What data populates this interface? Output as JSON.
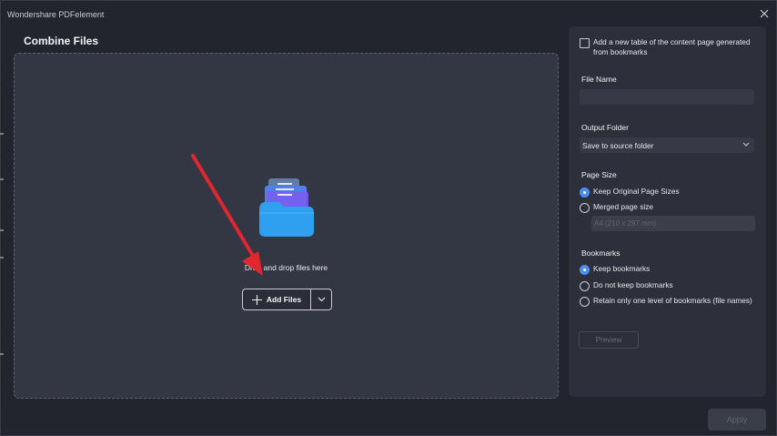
{
  "app": {
    "title": "Wondershare PDFelement"
  },
  "main": {
    "heading": "Combine Files",
    "drop_text": "Drag and drop files here",
    "add_files_label": "Add Files"
  },
  "panel": {
    "toc_checkbox_label": "Add a new table of the content page generated from bookmarks",
    "toc_checked": false,
    "file_name_label": "File Name",
    "file_name_value": "",
    "output_folder_label": "Output Folder",
    "output_folder_value": "Save to source folder",
    "page_size_label": "Page Size",
    "page_size_options": [
      "Keep Original Page Sizes",
      "Merged page size"
    ],
    "page_size_selected": "Keep Original Page Sizes",
    "merged_size_value": "A4 (210 x 297 mm)",
    "bookmarks_label": "Bookmarks",
    "bookmark_options": [
      "Keep bookmarks",
      "Do not keep bookmarks",
      "Retain only one level of bookmarks (file names)"
    ],
    "bookmark_selected": "Keep bookmarks",
    "preview_label": "Preview"
  },
  "footer": {
    "apply_label": "Apply"
  },
  "colors": {
    "accent": "#4a8ff7",
    "annotation_arrow": "#e0262e",
    "background": "#22252e"
  },
  "icons": [
    "close-icon",
    "folder-icon",
    "plus-icon",
    "chevron-down-icon"
  ]
}
